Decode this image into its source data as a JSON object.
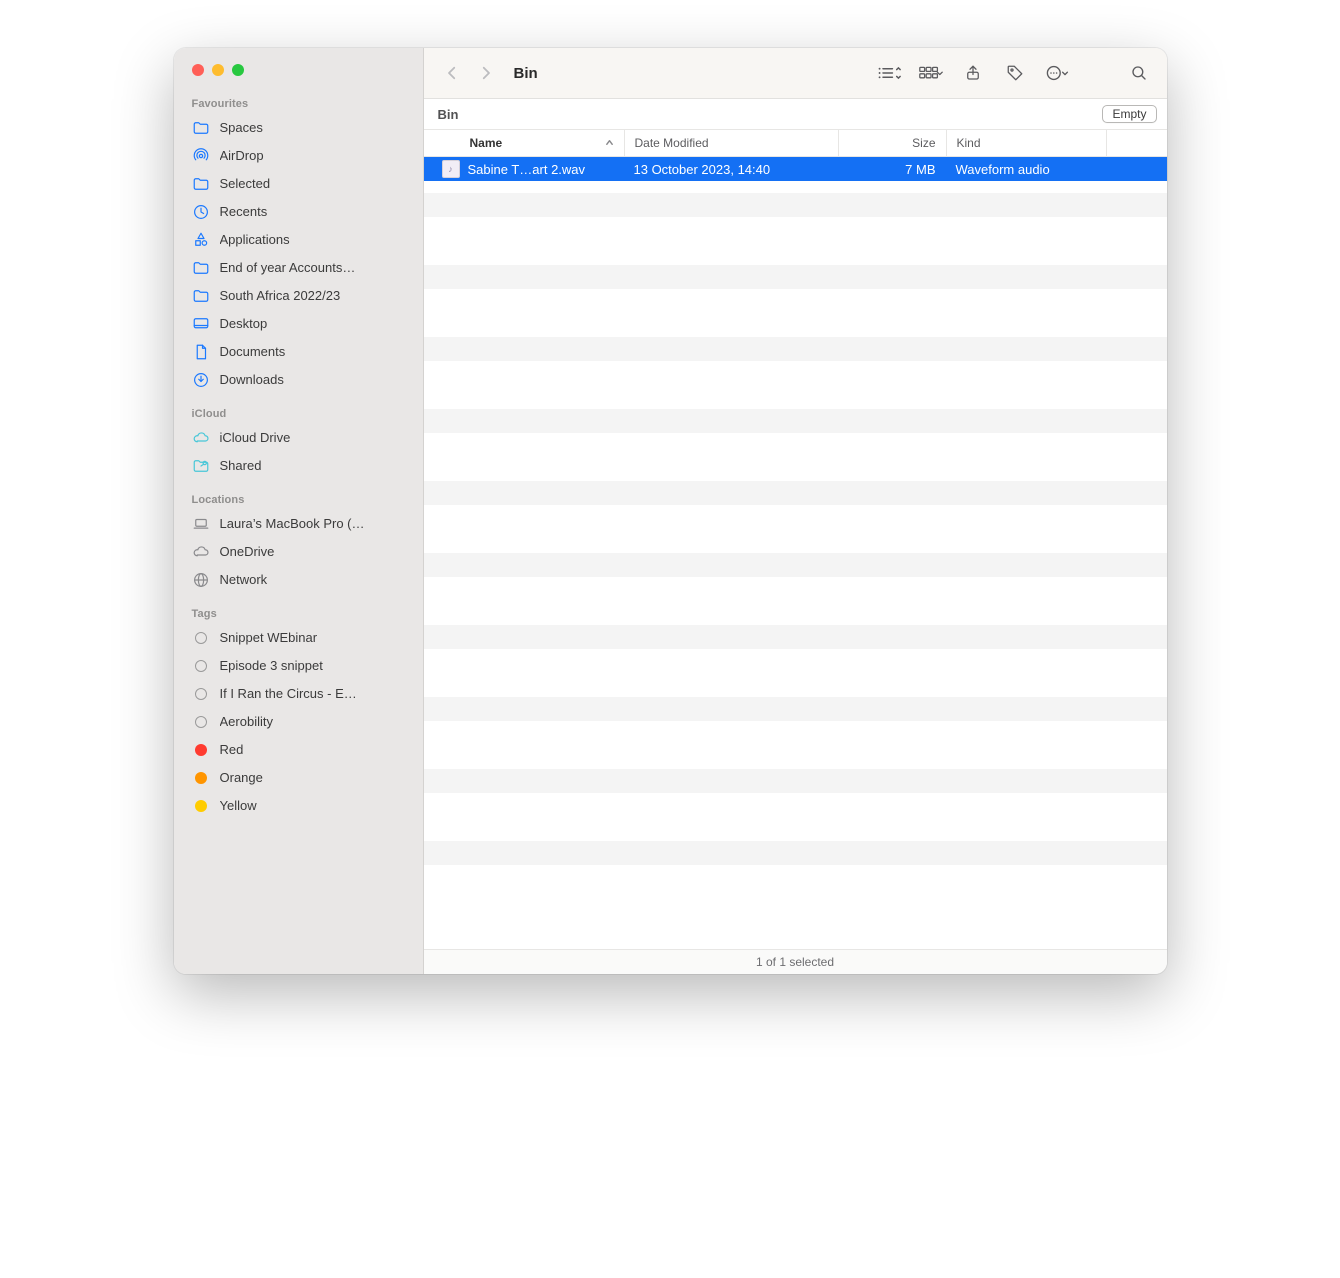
{
  "window": {
    "title": "Bin",
    "location_label": "Bin",
    "empty_button": "Empty",
    "status": "1 of 1 selected"
  },
  "toolbar": {
    "back_enabled": false,
    "forward_enabled": false
  },
  "columns": {
    "name": "Name",
    "date": "Date Modified",
    "size": "Size",
    "kind": "Kind",
    "sorted_by": "name",
    "sort_dir": "asc"
  },
  "rows": [
    {
      "name": "Sabine T…art 2.wav",
      "date": "13 October 2023, 14:40",
      "size": "7 MB",
      "kind": "Waveform audio",
      "selected": true
    }
  ],
  "placeholder_row_count": 20,
  "sidebar": {
    "sections": [
      {
        "heading": "Favourites",
        "items": [
          {
            "icon": "folder",
            "color": "#1b79ff",
            "label": "Spaces"
          },
          {
            "icon": "airdrop",
            "color": "#1b79ff",
            "label": "AirDrop"
          },
          {
            "icon": "folder",
            "color": "#1b79ff",
            "label": "Selected"
          },
          {
            "icon": "clock",
            "color": "#1b79ff",
            "label": "Recents"
          },
          {
            "icon": "apps",
            "color": "#1b79ff",
            "label": "Applications"
          },
          {
            "icon": "folder",
            "color": "#1b79ff",
            "label": "End of year Accounts…"
          },
          {
            "icon": "folder",
            "color": "#1b79ff",
            "label": "South Africa 2022/23"
          },
          {
            "icon": "desktop",
            "color": "#1b79ff",
            "label": "Desktop"
          },
          {
            "icon": "doc",
            "color": "#1b79ff",
            "label": "Documents"
          },
          {
            "icon": "download",
            "color": "#1b79ff",
            "label": "Downloads"
          }
        ]
      },
      {
        "heading": "iCloud",
        "items": [
          {
            "icon": "cloud",
            "color": "#48c7d8",
            "label": "iCloud Drive"
          },
          {
            "icon": "sharefolder",
            "color": "#48c7d8",
            "label": "Shared"
          }
        ]
      },
      {
        "heading": "Locations",
        "items": [
          {
            "icon": "laptop",
            "color": "#8a8a8d",
            "label": "Laura’s MacBook Pro (…"
          },
          {
            "icon": "cloud",
            "color": "#8a8a8d",
            "label": "OneDrive"
          },
          {
            "icon": "globe",
            "color": "#8a8a8d",
            "label": "Network"
          }
        ]
      },
      {
        "heading": "Tags",
        "items": [
          {
            "icon": "tag-empty",
            "label": "Snippet WEbinar"
          },
          {
            "icon": "tag-empty",
            "label": "Episode 3 snippet"
          },
          {
            "icon": "tag-empty",
            "label": "If I Ran the Circus - E…"
          },
          {
            "icon": "tag-empty",
            "label": "Aerobility"
          },
          {
            "icon": "tag-fill",
            "color": "#ff3b30",
            "label": "Red"
          },
          {
            "icon": "tag-fill",
            "color": "#ff9500",
            "label": "Orange"
          },
          {
            "icon": "tag-fill",
            "color": "#ffcc00",
            "label": "Yellow"
          }
        ]
      }
    ]
  }
}
